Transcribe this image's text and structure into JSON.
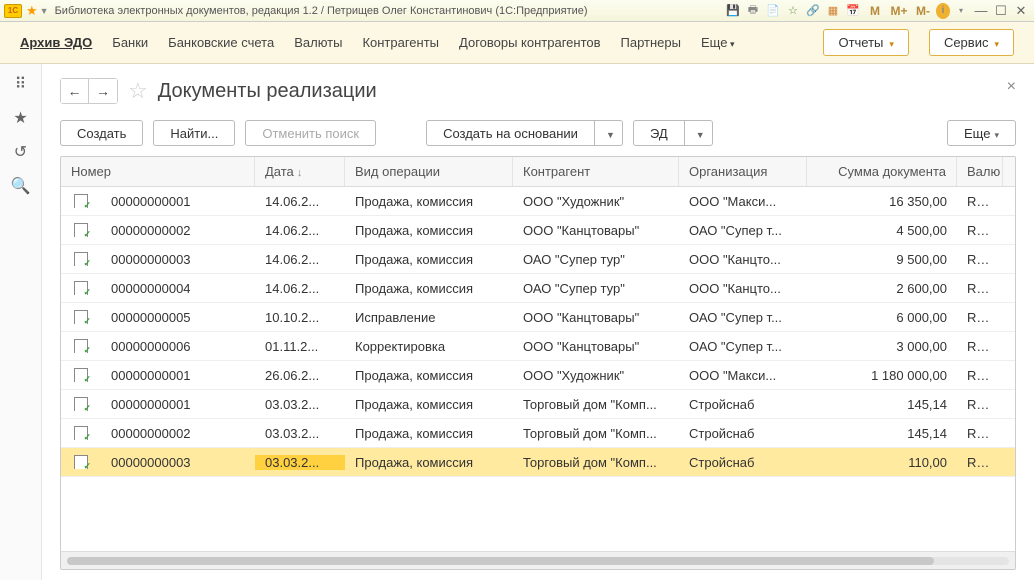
{
  "titlebar": {
    "text": "Библиотека электронных документов, редакция 1.2 / Петрищев Олег Константинович  (1С:Предприятие)"
  },
  "nav": {
    "items": [
      "Архив ЭДО",
      "Банки",
      "Банковские счета",
      "Валюты",
      "Контрагенты",
      "Договоры контрагентов",
      "Партнеры"
    ],
    "active_index": 0,
    "more": "Еще",
    "reports": "Отчеты",
    "service": "Сервис"
  },
  "page": {
    "title": "Документы реализации"
  },
  "toolbar": {
    "create": "Создать",
    "find": "Найти...",
    "cancel_search": "Отменить поиск",
    "create_based": "Создать на основании",
    "ed": "ЭД",
    "more": "Еще"
  },
  "columns": {
    "number": "Номер",
    "date": "Дата",
    "operation": "Вид операции",
    "contractor": "Контрагент",
    "org": "Организация",
    "sum": "Сумма документа",
    "currency": "Валю"
  },
  "rows": [
    {
      "num": "00000000001",
      "date": "14.06.2...",
      "oper": "Продажа, комиссия",
      "contr": "ООО \"Художник\"",
      "org": "ООО \"Макси...",
      "sum": "16 350,00",
      "cur": "RUB",
      "sel": false
    },
    {
      "num": "00000000002",
      "date": "14.06.2...",
      "oper": "Продажа, комиссия",
      "contr": "ООО \"Канцтовары\"",
      "org": "ОАО \"Супер т...",
      "sum": "4 500,00",
      "cur": "RUB",
      "sel": false
    },
    {
      "num": "00000000003",
      "date": "14.06.2...",
      "oper": "Продажа, комиссия",
      "contr": "ОАО \"Супер тур\"",
      "org": "ООО \"Канцто...",
      "sum": "9 500,00",
      "cur": "RUB",
      "sel": false
    },
    {
      "num": "00000000004",
      "date": "14.06.2...",
      "oper": "Продажа, комиссия",
      "contr": "ОАО \"Супер тур\"",
      "org": "ООО \"Канцто...",
      "sum": "2 600,00",
      "cur": "RUB",
      "sel": false
    },
    {
      "num": "00000000005",
      "date": "10.10.2...",
      "oper": "Исправление",
      "contr": "ООО \"Канцтовары\"",
      "org": "ОАО \"Супер т...",
      "sum": "6 000,00",
      "cur": "RUB",
      "sel": false
    },
    {
      "num": "00000000006",
      "date": "01.11.2...",
      "oper": "Корректировка",
      "contr": "ООО \"Канцтовары\"",
      "org": "ОАО \"Супер т...",
      "sum": "3 000,00",
      "cur": "RUB",
      "sel": false
    },
    {
      "num": "00000000001",
      "date": "26.06.2...",
      "oper": "Продажа, комиссия",
      "contr": "ООО \"Художник\"",
      "org": "ООО \"Макси...",
      "sum": "1 180 000,00",
      "cur": "RUB",
      "sel": false
    },
    {
      "num": "00000000001",
      "date": "03.03.2...",
      "oper": "Продажа, комиссия",
      "contr": "Торговый дом \"Комп...",
      "org": "Стройснаб",
      "sum": "145,14",
      "cur": "RUB",
      "sel": false
    },
    {
      "num": "00000000002",
      "date": "03.03.2...",
      "oper": "Продажа, комиссия",
      "contr": "Торговый дом \"Комп...",
      "org": "Стройснаб",
      "sum": "145,14",
      "cur": "RUB",
      "sel": false
    },
    {
      "num": "00000000003",
      "date": "03.03.2...",
      "oper": "Продажа, комиссия",
      "contr": "Торговый дом \"Комп...",
      "org": "Стройснаб",
      "sum": "110,00",
      "cur": "RUB",
      "sel": true
    }
  ]
}
